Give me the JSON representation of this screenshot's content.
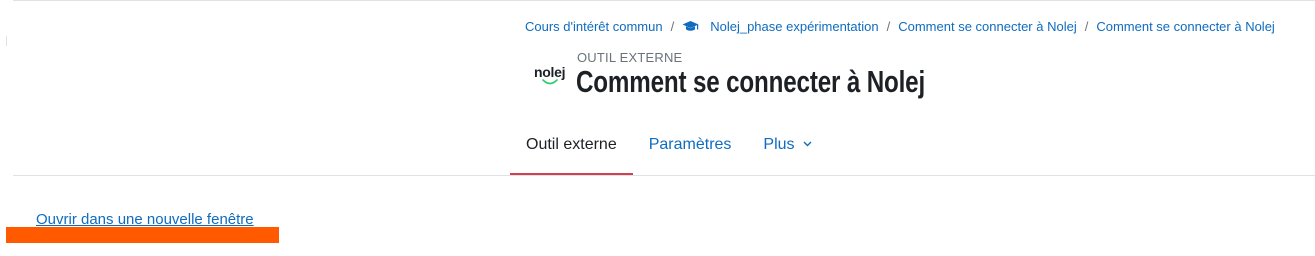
{
  "breadcrumb": {
    "items": [
      {
        "label": "Cours d'intérêt commun"
      },
      {
        "label": "Nolej_phase expérimentation",
        "icon": "graduation-cap-icon"
      },
      {
        "label": "Comment se connecter à Nolej"
      },
      {
        "label": "Comment se connecter à Nolej"
      }
    ],
    "separator": "/"
  },
  "header": {
    "pre_title": "OUTIL EXTERNE",
    "title": "Comment se connecter à Nolej",
    "activity_icon_text": "nolej",
    "activity_icon": "nolej-logo-icon"
  },
  "nav": {
    "tabs": [
      {
        "label": "Outil externe",
        "active": true
      },
      {
        "label": "Paramètres",
        "active": false
      },
      {
        "label": "Plus",
        "active": false,
        "icon": "chevron-down-icon"
      }
    ]
  },
  "content": {
    "open_link": "Ouvrir dans une nouvelle fenêtre"
  },
  "colors": {
    "link": "#0f6cbf",
    "text": "#1d2125",
    "active_tab_underline": "#d43f4d",
    "redaction": "#ff5a00",
    "logo_smile": "#2ecc71"
  }
}
